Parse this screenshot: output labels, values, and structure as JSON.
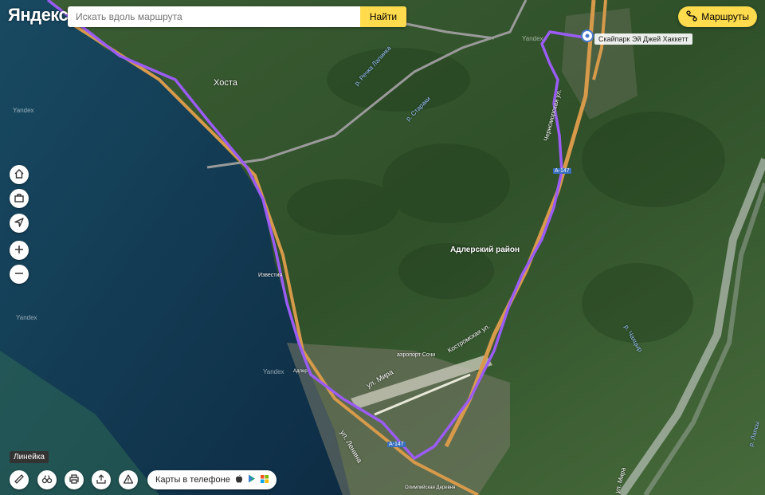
{
  "logo": "Яндекс",
  "search": {
    "placeholder": "Искать вдоль маршрута",
    "button": "Найти"
  },
  "routes_button": "Маршруты",
  "route": {
    "destination_marker": "B",
    "destination_label": "Скайпарк Эй Джей Хаккетт",
    "color": "#9b5cf5"
  },
  "map_labels": {
    "khosta": "Хоста",
    "adler_district": "Адлерский район",
    "river_lapinka": "р. Речка Лапинка",
    "river_staraki": "р. Стараки",
    "river_chakhtsyr": "р. Чахцыр",
    "river_laps": "р. Лапсы",
    "station_izvestiya": "Известия",
    "airport": "аэропорт Сочи",
    "street_mira": "ул. Мира",
    "street_lenina": "ул. Ленина",
    "street_kostromskaya": "Костромская ул.",
    "street_chernomorskaya": "Черноморская ул.",
    "street_mira2": "ул. Мира",
    "olympic_village": "Олимпийская Деревня",
    "adler": "Адлер",
    "road_a147_top": "А-147",
    "road_a147_bottom": "А-147"
  },
  "watermarks": [
    "Yandex",
    "Yandex",
    "Yandex",
    "Yandex"
  ],
  "tooltip": "Линейка",
  "phone_pill": "Карты в телефоне",
  "controls": {
    "left": [
      "home",
      "briefcase",
      "locate",
      "zoom-in",
      "zoom-out"
    ],
    "bottom": [
      "ruler",
      "panorama",
      "print",
      "share",
      "warning"
    ]
  },
  "colors": {
    "sea": "#0f3550",
    "land": "#3a5b32",
    "accent": "#ffdb4d",
    "road": "#d79a4a"
  }
}
